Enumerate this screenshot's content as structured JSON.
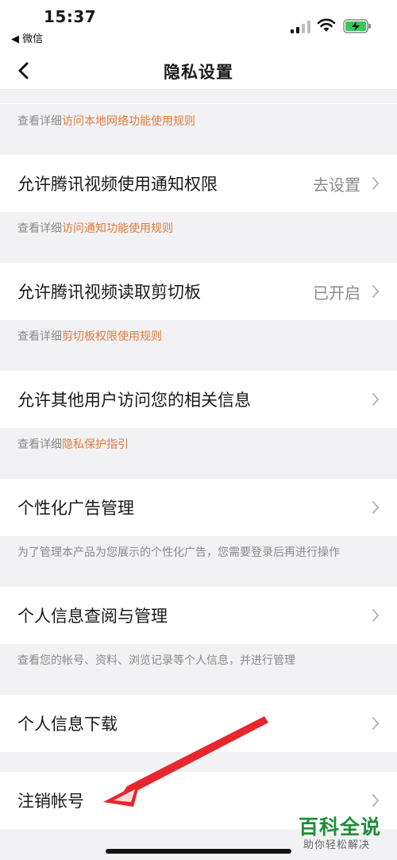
{
  "status": {
    "time": "15:37",
    "back_app": "◀ 微信"
  },
  "nav": {
    "title": "隐私设置"
  },
  "notes": {
    "local_network": {
      "prefix": "查看详细",
      "link": "访问本地网络功能使用规则"
    },
    "notification": {
      "prefix": "查看详细",
      "link": "访问通知功能使用规则"
    },
    "clipboard": {
      "prefix": "查看详细",
      "link": "剪切板权限使用规则"
    },
    "privacy": {
      "prefix": "查看详细",
      "link": "隐私保护指引"
    },
    "ads": "为了管理本产品为您展示的个性化广告，您需要登录后再进行操作",
    "personal_info": "查看您的帐号、资料、浏览记录等个人信息，并进行管理"
  },
  "rows": {
    "notification_permission": {
      "label": "允许腾讯视频使用通知权限",
      "value": "去设置"
    },
    "clipboard": {
      "label": "允许腾讯视频读取剪切板",
      "value": "已开启"
    },
    "others_access": {
      "label": "允许其他用户访问您的相关信息"
    },
    "ads": {
      "label": "个性化广告管理"
    },
    "personal_info": {
      "label": "个人信息查阅与管理"
    },
    "download": {
      "label": "个人信息下载"
    },
    "cancel_account": {
      "label": "注销帐号"
    }
  },
  "watermark": {
    "main": "百科全说",
    "sub": "助你轻松解决"
  },
  "colors": {
    "link": "#e07a3c",
    "annotation_arrow": "#e8262b",
    "watermark": "#1f8d3a"
  }
}
